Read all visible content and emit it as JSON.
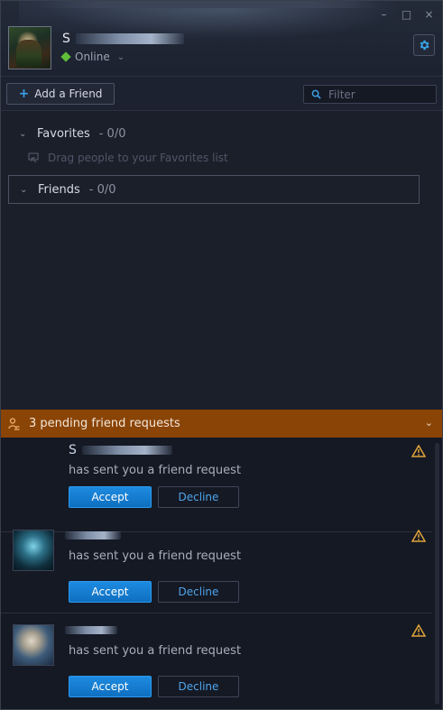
{
  "window": {
    "controls": {
      "close": "×",
      "minimize": "–",
      "maximize": "□"
    }
  },
  "profile": {
    "name_initial": "S",
    "status": "Online",
    "status_color": "#5fbf3a",
    "settings_icon": "gear-icon"
  },
  "toolbar": {
    "add_friend_label": "Add a Friend",
    "filter_placeholder": "Filter"
  },
  "groups": {
    "favorites": {
      "name": "Favorites",
      "count": "- 0/0"
    },
    "drag_hint": "Drag people to your Favorites list",
    "friends": {
      "name": "Friends",
      "count": "- 0/0"
    }
  },
  "pending": {
    "label": "3 pending friend requests",
    "color": "#8a4406"
  },
  "requests": [
    {
      "name_initial": "S",
      "message": "has sent you a friend request",
      "accept": "Accept",
      "decline": "Decline"
    },
    {
      "name_initial": "",
      "message": "has sent you a friend request",
      "accept": "Accept",
      "decline": "Decline"
    },
    {
      "name_initial": "",
      "message": "has sent you a friend request",
      "accept": "Accept",
      "decline": "Decline"
    }
  ],
  "colors": {
    "accent": "#1d8be0",
    "warning": "#e2a43a"
  }
}
